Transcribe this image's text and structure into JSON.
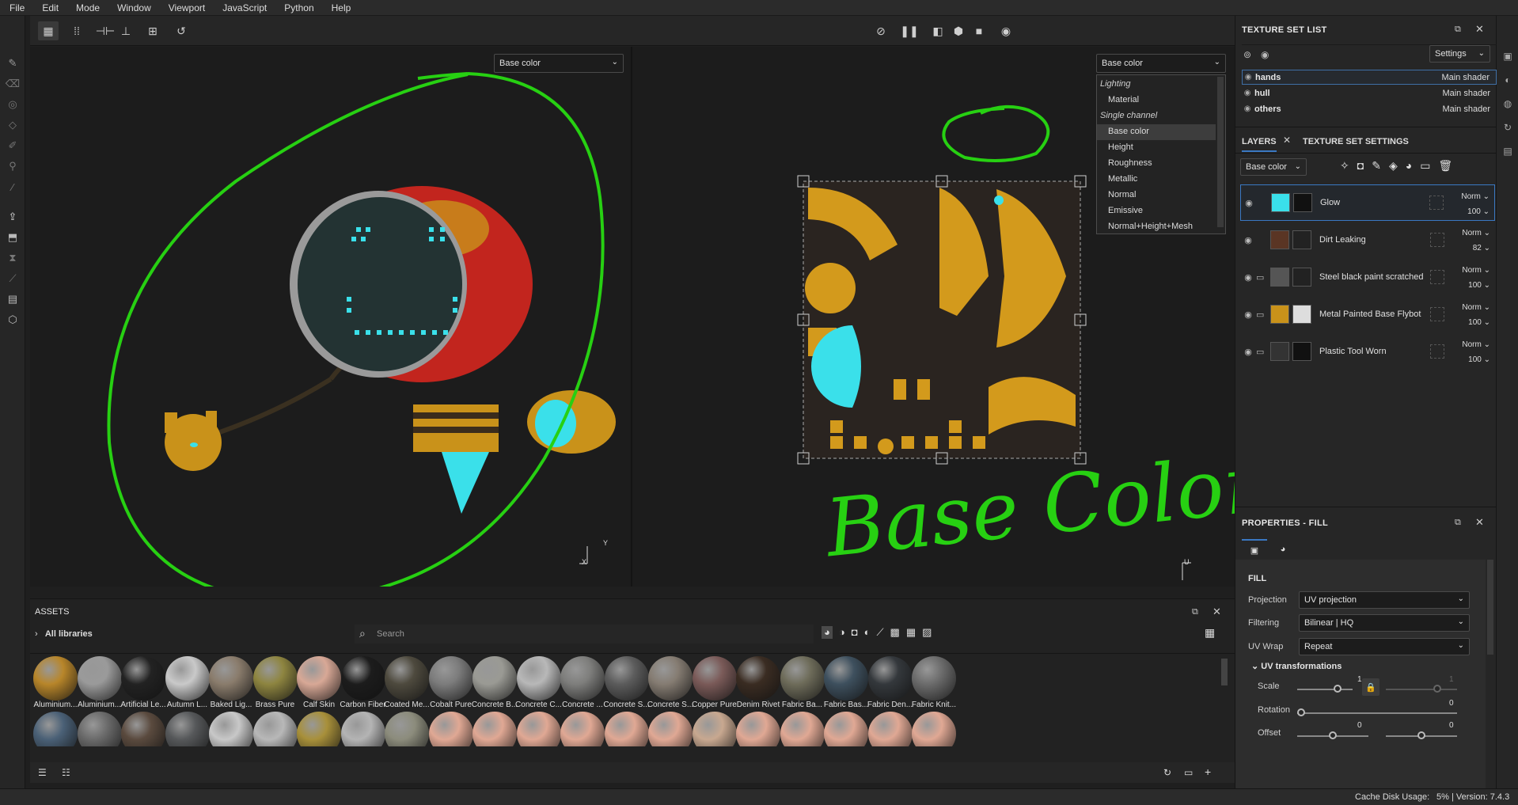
{
  "menu": [
    "File",
    "Edit",
    "Mode",
    "Window",
    "Viewport",
    "JavaScript",
    "Python",
    "Help"
  ],
  "viewport": {
    "left_channel": "Base color",
    "right_channel": "Base color",
    "channel_dropdown": [
      {
        "label": "Lighting",
        "cat": true
      },
      {
        "label": "Material",
        "cat": false
      },
      {
        "label": "Single channel",
        "cat": true
      },
      {
        "label": "Base color",
        "cat": false,
        "selected": true
      },
      {
        "label": "Height",
        "cat": false
      },
      {
        "label": "Roughness",
        "cat": false
      },
      {
        "label": "Metallic",
        "cat": false
      },
      {
        "label": "Normal",
        "cat": false
      },
      {
        "label": "Emissive",
        "cat": false
      },
      {
        "label": "Normal+Height+Mesh",
        "cat": false
      }
    ],
    "axis_y": "Y",
    "axis_x": "X",
    "axis_u": "U",
    "annotation": "Base Color",
    "annotation_color": "#27d012"
  },
  "texture_set_list": {
    "title": "TEXTURE SET LIST",
    "settings_label": "Settings",
    "sets": [
      {
        "name": "hands",
        "shader": "Main shader"
      },
      {
        "name": "hull",
        "shader": "Main shader"
      },
      {
        "name": "others",
        "shader": "Main shader"
      }
    ]
  },
  "layers": {
    "tab_layers": "LAYERS",
    "tab_settings": "TEXTURE SET SETTINGS",
    "channel": "Base color",
    "items": [
      {
        "name": "Glow",
        "blend": "Norm",
        "opacity": "100"
      },
      {
        "name": "Dirt Leaking",
        "blend": "Norm",
        "opacity": "82"
      },
      {
        "name": "Steel black paint scratched",
        "blend": "Norm",
        "opacity": "100"
      },
      {
        "name": "Metal Painted Base Flybot",
        "blend": "Norm",
        "opacity": "100"
      },
      {
        "name": "Plastic Tool Worn",
        "blend": "Norm",
        "opacity": "100"
      }
    ]
  },
  "properties": {
    "title": "PROPERTIES - FILL",
    "section": "FILL",
    "projection_label": "Projection",
    "projection": "UV projection",
    "filtering_label": "Filtering",
    "filtering": "Bilinear | HQ",
    "uvwrap_label": "UV Wrap",
    "uvwrap": "Repeat",
    "uvt_label": "UV transformations",
    "scale_label": "Scale",
    "scale_value": "1",
    "scale_value2": "1",
    "rotation_label": "Rotation",
    "rotation_value": "0",
    "offset_label": "Offset",
    "offset_x": "0",
    "offset_y": "0"
  },
  "assets": {
    "title": "ASSETS",
    "library": "All libraries",
    "search_placeholder": "Search",
    "materials": [
      {
        "name": "Aluminium...",
        "color": "#b8862a"
      },
      {
        "name": "Aluminium...",
        "color": "#9a9a9a"
      },
      {
        "name": "Artificial Le...",
        "color": "#222222"
      },
      {
        "name": "Autumn L...",
        "color": "#c9c9c9"
      },
      {
        "name": "Baked Lig...",
        "color": "#8a7c6c"
      },
      {
        "name": "Brass Pure",
        "color": "#8e8540"
      },
      {
        "name": "Calf Skin",
        "color": "#d8a896"
      },
      {
        "name": "Carbon Fiber",
        "color": "#1c1c1c"
      },
      {
        "name": "Coated Me...",
        "color": "#4e4a3e"
      },
      {
        "name": "Cobalt Pure",
        "color": "#7c7c7c"
      },
      {
        "name": "Concrete B...",
        "color": "#9a9a94"
      },
      {
        "name": "Concrete C...",
        "color": "#b8b8b8"
      },
      {
        "name": "Concrete ...",
        "color": "#7e7e7c"
      },
      {
        "name": "Concrete S...",
        "color": "#5c5c5c"
      },
      {
        "name": "Concrete S...",
        "color": "#857c72"
      },
      {
        "name": "Copper Pure",
        "color": "#7a5a58"
      },
      {
        "name": "Denim Rivet",
        "color": "#3a2c22"
      },
      {
        "name": "Fabric Ba...",
        "color": "#6e6c5a"
      },
      {
        "name": "Fabric Bas...",
        "color": "#3e505e"
      },
      {
        "name": "Fabric Den...",
        "color": "#34383c"
      },
      {
        "name": "Fabric Knit...",
        "color": "#6c6c6c"
      }
    ],
    "row2_colors": [
      "#4a6076",
      "#6a6a6a",
      "#5a4a3e",
      "#56585a",
      "#c8c8c8",
      "#b8b8b8",
      "#a8903a",
      "#b4b4b4",
      "#8c8c7c",
      "#e0a894",
      "#e0a894",
      "#e0a894",
      "#e0a894",
      "#e0a894",
      "#e0a894",
      "#c8a890",
      "#e0a894",
      "#e0a894",
      "#e0a894",
      "#e0a894",
      "#e0a894"
    ]
  },
  "status": {
    "cache_label": "Cache Disk Usage:",
    "cache_value": "5%",
    "version": "| Version: 7.4.3"
  }
}
